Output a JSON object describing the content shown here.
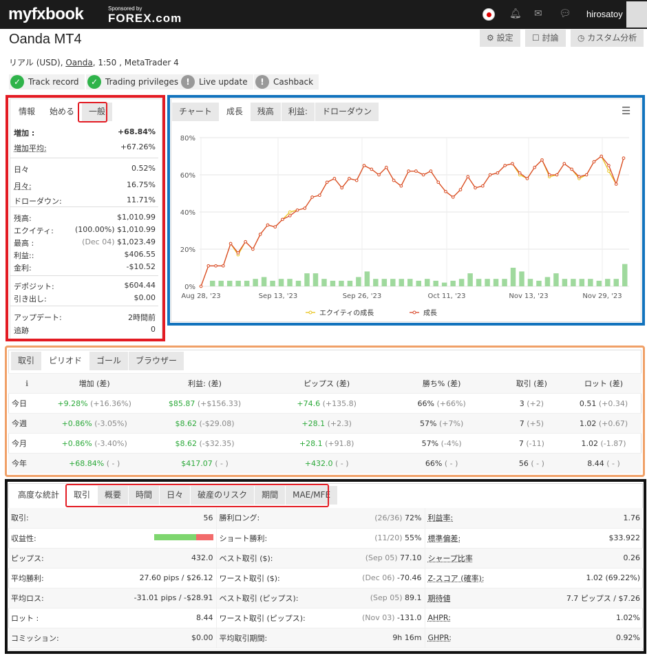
{
  "nav": {
    "logo": "myfxbook",
    "sponsor_line": "Sponsored by",
    "sponsor": "FOREX.com",
    "username": "hirosatoy"
  },
  "header": {
    "title": "Oanda MT4",
    "subtitle_prefix": "リアル (USD), ",
    "broker": "Oanda",
    "subtitle_suffix": ", 1:50 , MetaTrader 4",
    "btn_settings": "⚙ 設定",
    "btn_discuss": "☐ 討論",
    "btn_custom": "◷ カスタム分析"
  },
  "badges": [
    {
      "label": "Track record",
      "status": "ok"
    },
    {
      "label": "Trading privileges",
      "status": "ok"
    },
    {
      "label": "Live update",
      "status": "warn"
    },
    {
      "label": "Cashback",
      "status": "warn"
    }
  ],
  "left_tabs": [
    "情報",
    "始める",
    "一般"
  ],
  "stats": [
    {
      "k": "増加 :",
      "v": "+68.84%",
      "green": true
    },
    {
      "k": "増加平均:",
      "v": "+67.26%",
      "green": true
    },
    {
      "k": "日々",
      "v": "0.52%"
    },
    {
      "k": "月々:",
      "v": "16.75%"
    },
    {
      "k": "ドローダウン:",
      "v": "11.71%"
    },
    {
      "k": "残高:",
      "v": "$1,010.99"
    },
    {
      "k": "エクイティ:",
      "v": "(100.00%) $1,010.99"
    },
    {
      "k": "最高 :",
      "v_grey": "(Dec 04)",
      "v": "$1,023.49"
    },
    {
      "k": "利益::",
      "v": "$406.55",
      "green": true
    },
    {
      "k": "金利:",
      "v": "-$10.52"
    },
    {
      "k": "デポジット:",
      "v": "$604.44"
    },
    {
      "k": "引き出し:",
      "v": "$0.00"
    },
    {
      "k": "アップデート:",
      "v": "2時間前"
    },
    {
      "k": "追跡",
      "v": "0"
    }
  ],
  "chart_tabs": [
    "チャート",
    "成長",
    "残高",
    "利益:",
    "ドローダウン"
  ],
  "chart_data": {
    "type": "line",
    "x_ticks": [
      "Aug 28, '23",
      "Sep 13, '23",
      "Sep 26, '23",
      "Oct 11, '23",
      "Nov 13, '23",
      "Nov 29, '23"
    ],
    "y_ticks": [
      "0%",
      "20%",
      "40%",
      "60%",
      "80%"
    ],
    "ylim": [
      0,
      80
    ],
    "series": [
      {
        "name": "エクイティの成長",
        "color": "#e8c21a",
        "values": [
          0,
          11,
          11,
          11,
          23,
          17,
          24,
          20,
          28,
          33,
          32,
          36,
          40,
          41,
          42,
          48,
          49,
          56,
          58,
          53,
          58,
          57,
          65,
          63,
          60,
          64,
          57,
          54,
          62,
          62,
          60,
          62,
          56,
          51,
          48,
          52,
          59,
          53,
          54,
          60,
          61,
          65,
          66,
          60,
          58,
          64,
          68,
          59,
          60,
          66,
          63,
          58,
          60,
          67,
          70,
          62,
          55,
          69
        ]
      },
      {
        "name": "成長",
        "color": "#d9482b",
        "values": [
          0,
          11,
          11,
          11,
          23,
          18,
          24,
          20,
          28,
          33,
          32,
          36,
          38,
          41,
          42,
          48,
          49,
          56,
          58,
          53,
          58,
          57,
          65,
          63,
          60,
          64,
          57,
          54,
          62,
          62,
          60,
          62,
          56,
          51,
          48,
          52,
          59,
          53,
          54,
          60,
          61,
          65,
          66,
          61,
          58,
          64,
          68,
          60,
          60,
          66,
          63,
          59,
          60,
          67,
          70,
          65,
          55,
          69
        ]
      }
    ],
    "bars": [
      0,
      3,
      3,
      3,
      3,
      3,
      4,
      5,
      3,
      4,
      4,
      3,
      7,
      7,
      4,
      3,
      3,
      3,
      5,
      8,
      4,
      4,
      4,
      4,
      4,
      3,
      4,
      3,
      2,
      3,
      4,
      7,
      4,
      4,
      4,
      4,
      10,
      8,
      4,
      3,
      5,
      7,
      4,
      4,
      4,
      4,
      3,
      4,
      4,
      12
    ]
  },
  "period": {
    "tabs": [
      "取引",
      "ピリオド",
      "ゴール",
      "ブラウザー"
    ],
    "headers": [
      "",
      "増加 (差)",
      "利益: (差)",
      "ピップス (差)",
      "勝ち% (差)",
      "取引 (差)",
      "ロット (差)"
    ],
    "rows": [
      {
        "p": "今日",
        "gain": "+9.28%",
        "gd": "(+16.36%)",
        "profit": "$85.87",
        "pd": "(+$156.33)",
        "pips": "+74.6",
        "pid": "(+135.8)",
        "win": "66%",
        "wd": "(+66%)",
        "trades": "3",
        "td": "(+2)",
        "lots": "0.51",
        "ld": "(+0.34)"
      },
      {
        "p": "今週",
        "gain": "+0.86%",
        "gd": "(-3.05%)",
        "profit": "$8.62",
        "pd": "(-$29.08)",
        "pips": "+28.1",
        "pid": "(+2.3)",
        "win": "57%",
        "wd": "(+7%)",
        "trades": "7",
        "td": "(+5)",
        "lots": "1.02",
        "ld": "(+0.67)"
      },
      {
        "p": "今月",
        "gain": "+0.86%",
        "gd": "(-3.40%)",
        "profit": "$8.62",
        "pd": "(-$32.35)",
        "pips": "+28.1",
        "pid": "(+91.8)",
        "win": "57%",
        "wd": "(-4%)",
        "trades": "7",
        "td": "(-11)",
        "lots": "1.02",
        "ld": "(-1.87)"
      },
      {
        "p": "今年",
        "gain": "+68.84%",
        "gd": "( - )",
        "profit": "$417.07",
        "pd": "( - )",
        "pips": "+432.0",
        "pid": "( - )",
        "win": "66%",
        "wd": "( - )",
        "trades": "56",
        "td": "( - )",
        "lots": "8.44",
        "ld": "( - )"
      }
    ]
  },
  "advanced": {
    "label": "高度な統計",
    "tabs": [
      "取引",
      "概要",
      "時間",
      "日々",
      "破産のリスク",
      "期間",
      "MAE/MFE"
    ],
    "profitability": {
      "win_fraction": 0.72
    },
    "rows": [
      [
        "取引:",
        "56",
        "勝利ロング:",
        "(26/36)",
        "72%",
        "利益率:",
        "1.76"
      ],
      [
        "収益性:",
        "",
        "ショート勝利:",
        "(11/20)",
        "55%",
        "標準偏差:",
        "$33.922"
      ],
      [
        "ピップス:",
        "432.0",
        "ベスト取引 ($):",
        "(Sep 05)",
        "77.10",
        "シャープ比率",
        "0.26"
      ],
      [
        "平均勝利:",
        "27.60 pips / $26.12",
        "ワースト取引 ($):",
        "(Dec 06)",
        "-70.46",
        "Z-スコア (確率):",
        "1.02 (69.22%)"
      ],
      [
        "平均ロス:",
        "-31.01 pips / -$28.91",
        "ベスト取引 (ピップス):",
        "(Sep 05)",
        "89.1",
        "期待値",
        "7.7 ピップス / $7.26"
      ],
      [
        "ロット :",
        "8.44",
        "ワースト取引 (ピップス):",
        "(Nov 03)",
        "-131.0",
        "AHPR:",
        "1.02%"
      ],
      [
        "コミッション:",
        "$0.00",
        "平均取引期間:",
        "",
        "9h 16m",
        "GHPR:",
        "0.92%"
      ]
    ]
  },
  "highlight_colors": {
    "red": "#e31b23",
    "blue": "#1273bd",
    "orange": "#f0a067",
    "black": "#111111"
  }
}
